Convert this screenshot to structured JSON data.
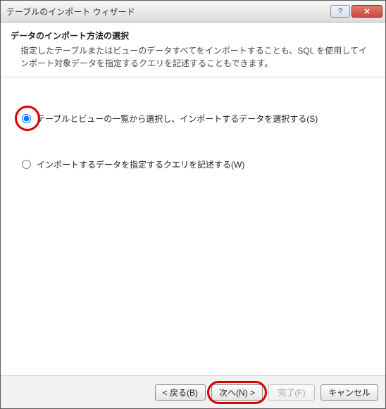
{
  "titlebar": {
    "title": "テーブルのインポート ウィザード",
    "help": "?",
    "close": "✕"
  },
  "header": {
    "title": "データのインポート方法の選択",
    "description": "指定したテーブルまたはビューのデータすべてをインポートすることも、SQL を使用してインポート対象データを指定するクエリを記述することもできます。"
  },
  "options": {
    "opt1": "テーブルとビューの一覧から選択し、インポートするデータを選択する(S)",
    "opt2": "インポートするデータを指定するクエリを記述する(W)"
  },
  "buttons": {
    "back": "< 戻る(B)",
    "next": "次へ(N) >",
    "finish": "完了(F)",
    "cancel": "キャンセル"
  }
}
